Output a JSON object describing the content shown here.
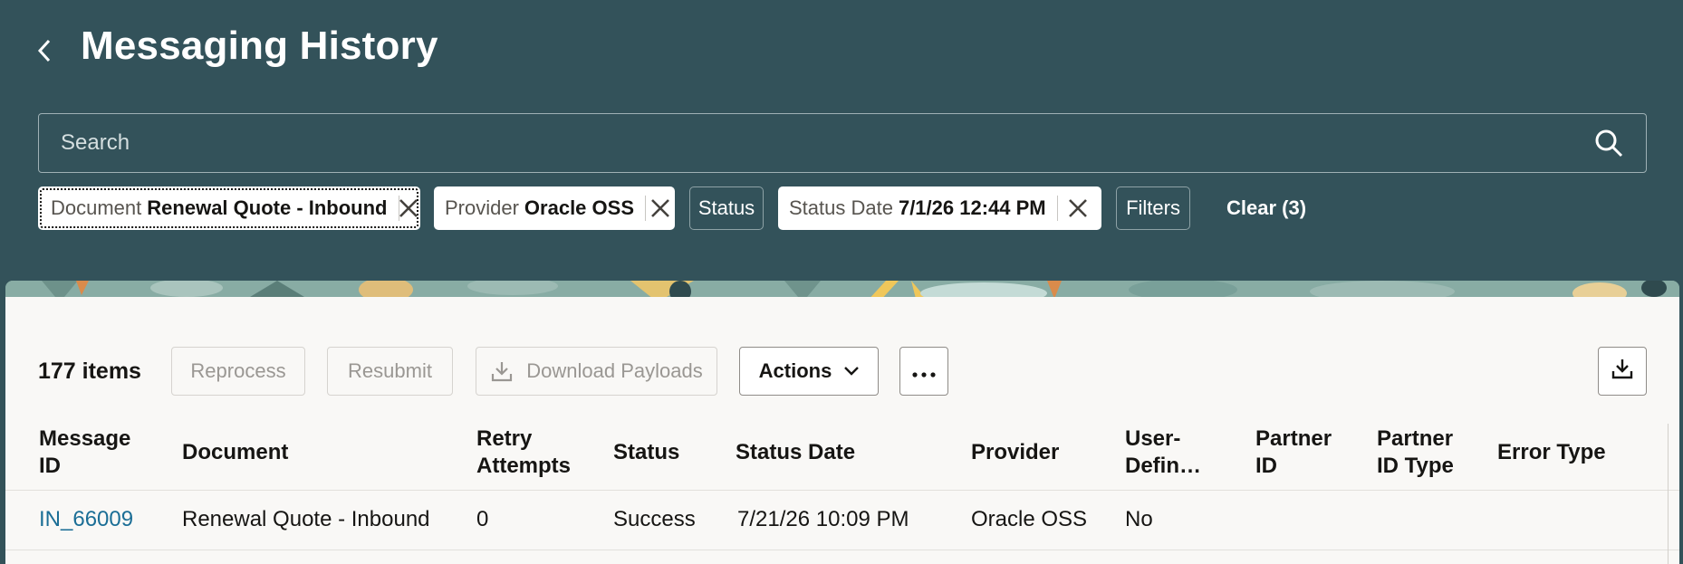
{
  "header": {
    "title": "Messaging History",
    "search": {
      "placeholder": "Search",
      "value": ""
    }
  },
  "filters": {
    "chips": [
      {
        "label": "Document",
        "value": "Renewal Quote - Inbound"
      },
      {
        "label": "Provider",
        "value": "Oracle OSS"
      },
      {
        "label": "Status"
      },
      {
        "label": "Status Date",
        "value": "7/1/26 12:44 PM"
      },
      {
        "label": "Filters"
      }
    ],
    "clear_label": "Clear (3)"
  },
  "toolbar": {
    "count": "177 items",
    "reprocess": "Reprocess",
    "resubmit": "Resubmit",
    "download_payloads": "Download Payloads",
    "actions": "Actions"
  },
  "table": {
    "columns": [
      "Message ID",
      "Document",
      "Retry Attempts",
      "Status",
      "Status Date",
      "Provider",
      "User-Defin…",
      "Partner ID",
      "Partner ID Type",
      "Error Type"
    ],
    "column_lines": [
      [
        "Message",
        "ID"
      ],
      [
        "Document"
      ],
      [
        "Retry",
        "Attempts"
      ],
      [
        "Status"
      ],
      [
        "Status Date"
      ],
      [
        "Provider"
      ],
      [
        "User-",
        "Defin…"
      ],
      [
        "Partner",
        "ID"
      ],
      [
        "Partner",
        "ID Type"
      ],
      [
        "Error Type"
      ]
    ],
    "rows": [
      {
        "message_id": "IN_66009",
        "document": "Renewal Quote - Inbound",
        "retry_attempts": "0",
        "status": "Success",
        "status_date": "7/21/26 10:09 PM",
        "provider": "Oracle OSS",
        "user_defined": "No",
        "partner_id": "",
        "partner_id_type": "",
        "error_type": ""
      }
    ]
  },
  "colors": {
    "header_bg": "#33525a",
    "panel_bg": "#f9f8f6",
    "link": "#1b6e96"
  }
}
